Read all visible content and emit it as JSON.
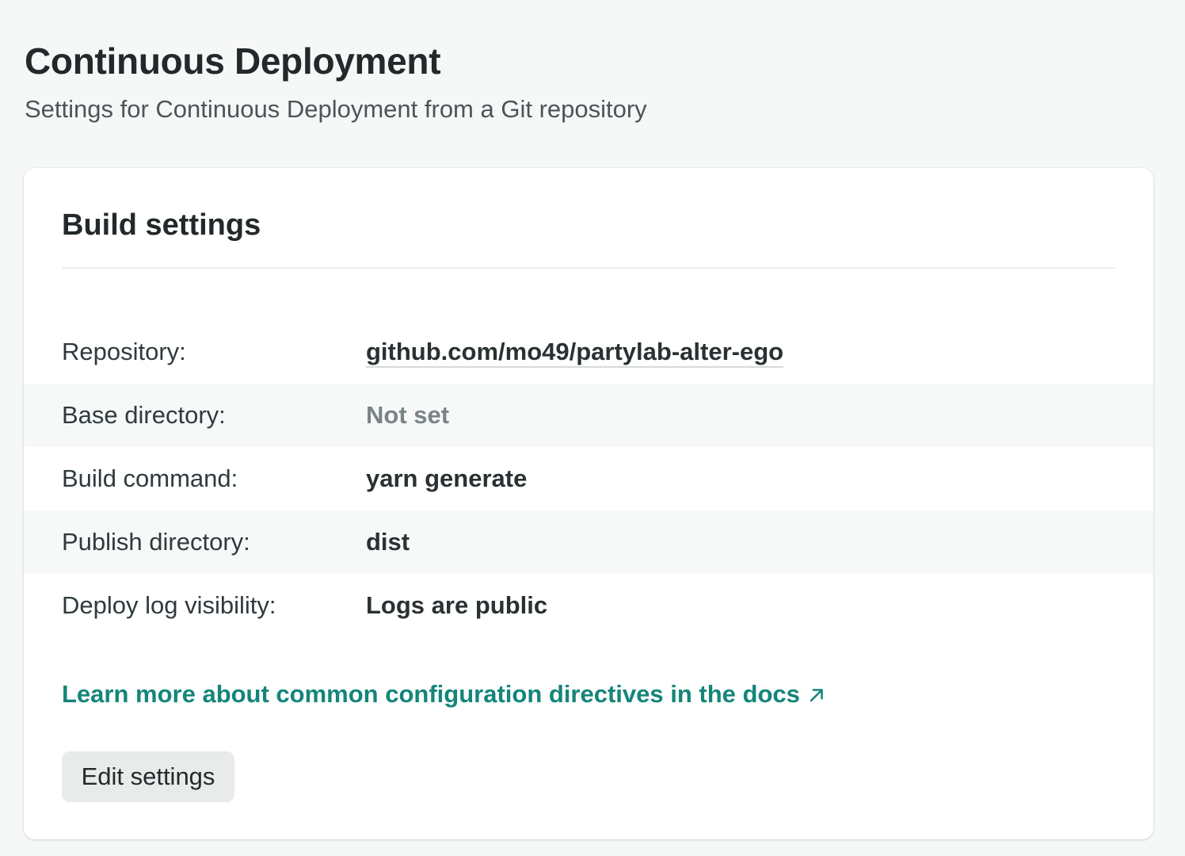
{
  "page": {
    "title": "Continuous Deployment",
    "subtitle": "Settings for Continuous Deployment from a Git repository"
  },
  "card": {
    "title": "Build settings",
    "rows": [
      {
        "label": "Repository:",
        "value": "github.com/mo49/partylab-alter-ego"
      },
      {
        "label": "Base directory:",
        "value": "Not set"
      },
      {
        "label": "Build command:",
        "value": "yarn generate"
      },
      {
        "label": "Publish directory:",
        "value": "dist"
      },
      {
        "label": "Deploy log visibility:",
        "value": "Logs are public"
      }
    ],
    "docs_link": "Learn more about common configuration directives in the docs",
    "docs_link_icon": "external-arrow-icon",
    "edit_button": "Edit settings"
  },
  "colors": {
    "background": "#f6f8f8",
    "card": "#ffffff",
    "link": "#14857a",
    "muted_value": "#7a8386",
    "alt_row": "#f7f9f9",
    "button": "#e9ebeb"
  }
}
